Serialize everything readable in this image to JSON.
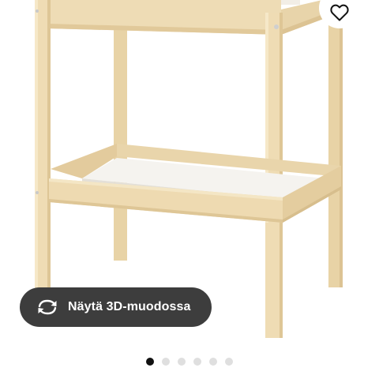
{
  "product_view": {
    "view_3d_label": "Näytä 3D-muodossa",
    "favorite_icon": "heart-outline-icon",
    "view_3d_icon": "rotate-arrows-icon"
  },
  "carousel": {
    "total_images": 6,
    "active_index": 0
  },
  "colors": {
    "wood": "#eedcb5",
    "wood_shadow": "#e1c99a",
    "button_bg": "#3d3d3d",
    "dot_active": "#111111",
    "dot_inactive": "#dfdfdf"
  }
}
